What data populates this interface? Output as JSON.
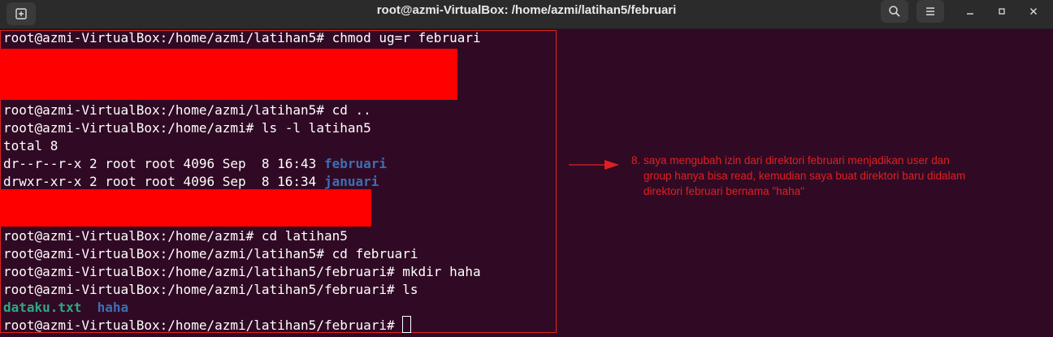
{
  "window": {
    "title": "root@azmi-VirtualBox: /home/azmi/latihan5/februari"
  },
  "toolbar": {
    "new_tab_icon": "new-tab-icon",
    "search_icon": "search-icon",
    "menu_icon": "hamburger-menu-icon",
    "minimize_icon": "minimize-icon",
    "maximize_icon": "maximize-icon",
    "close_icon": "close-icon"
  },
  "terminal": {
    "lines": [
      "root@azmi-VirtualBox:/home/azmi/latihan5# chmod ug=r februari",
      "root@azmi-VirtualBox:/home/azmi/latihan5# cd ..",
      "root@azmi-VirtualBox:/home/azmi# ls -l latihan5",
      "total 8",
      "dr--r--r-x 2 root root 4096 Sep  8 16:43 ",
      "februari",
      "drwxr-xr-x 2 root root 4096 Sep  8 16:34 ",
      "januari",
      "root@azmi-VirtualBox:/home/azmi# cd latihan5",
      "root@azmi-VirtualBox:/home/azmi/latihan5# cd februari",
      "root@azmi-VirtualBox:/home/azmi/latihan5/februari# mkdir haha",
      "root@azmi-VirtualBox:/home/azmi/latihan5/februari# ls",
      "dataku.txt",
      "haha",
      "root@azmi-VirtualBox:/home/azmi/latihan5/februari# "
    ]
  },
  "annotation": {
    "line1": "8. saya mengubah izin dari direktori februari menjadikan user dan",
    "line2": "group hanya bisa read, kemudian saya buat direktori baru didalam",
    "line3": "direktori februari bernama \"haha\""
  },
  "colors": {
    "terminal_bg": "#300a24",
    "directory": "#3d6eb5",
    "file": "#2ea885",
    "redaction": "#ff0000",
    "annotation": "#e02020"
  }
}
